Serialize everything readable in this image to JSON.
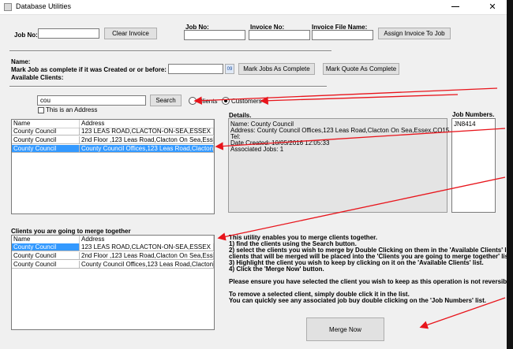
{
  "window": {
    "title": "Database Utilities",
    "close_glyph": "✕"
  },
  "invoice": {
    "job_no_label": "Job No:",
    "job_no_value": "",
    "clear_label": "Clear Invoice",
    "job_no_label2": "Job No:",
    "invoice_no_label": "Invoice No:",
    "invoice_file_label": "Invoice File Name:",
    "assign_label": "Assign Invoice To Job"
  },
  "complete": {
    "name_label": "Name:",
    "mark_label": "Mark Job as complete if it was Created or or before:",
    "date_value": "",
    "calendar_glyph": "09",
    "mark_jobs_label": "Mark Jobs As Complete",
    "mark_quote_label": "Mark Quote As Complete"
  },
  "clients": {
    "available_label": "Available Clients:",
    "search_value": "cou",
    "search_button": "Search",
    "radio_clients": "Clients",
    "radio_customers": "Customers",
    "checkbox_address": "This is an Address",
    "columns": [
      "Name",
      "Address"
    ],
    "rows": [
      {
        "name": "County Council",
        "address": "123 LEAS ROAD,CLACTON-ON-SEA,ESSEX"
      },
      {
        "name": "County Council",
        "address": "2nd Floor ,123 Leas Road,Clacton On Sea,Essex"
      },
      {
        "name": "County Council",
        "address": "County Council Offices,123 Leas Road,Clacton On Sea"
      }
    ]
  },
  "details": {
    "label": "Details.",
    "line1": "Name: County Council",
    "line2": "Address: County Council Offices,123 Leas Road,Clacton On Sea,Essex,CO15 1DP",
    "line3": "Tel:",
    "line4": "Date Created: 10/05/2016 12:05:33",
    "line5": "Associated Jobs: 1"
  },
  "job_numbers": {
    "label": "Job Numbers.",
    "items": [
      "JN8414"
    ]
  },
  "merge": {
    "label": "Clients you are going to merge together",
    "columns": [
      "Name",
      "Address"
    ],
    "rows": [
      {
        "name": "County Council",
        "address": "123 LEAS ROAD,CLACTON-ON-SEA,ESSEX"
      },
      {
        "name": "County Council",
        "address": "2nd Floor ,123 Leas Road,Clacton On Sea,Essex"
      },
      {
        "name": "County Council",
        "address": "County Council Offices,123 Leas Road,Clacton On Sea"
      }
    ],
    "instructions": [
      "This utility enables you to merge clients together.",
      "1) find the clients using the Search button.",
      "2) select the clients you wish to merge by Double Clicking on them in the 'Available Clients' list.",
      "clients that will be merged will be placed into the 'Clients you are going to merge together' list.",
      "3) Highlight the client you wish to keep by clicking on it on the 'Available Clients' list.",
      "4) Click the 'Merge Now' button.",
      "",
      "Please ensure you have selected the client you wish to keep as this operation is not reversible.",
      "",
      "To remove a selected client, simply double click it in the list.",
      "You can quickly see any associated job buy double clicking on the 'Job Numbers' list."
    ],
    "merge_button": "Merge Now"
  },
  "colors": {
    "selection": "#3399ff",
    "annotation_arrow": "#e8141b"
  }
}
